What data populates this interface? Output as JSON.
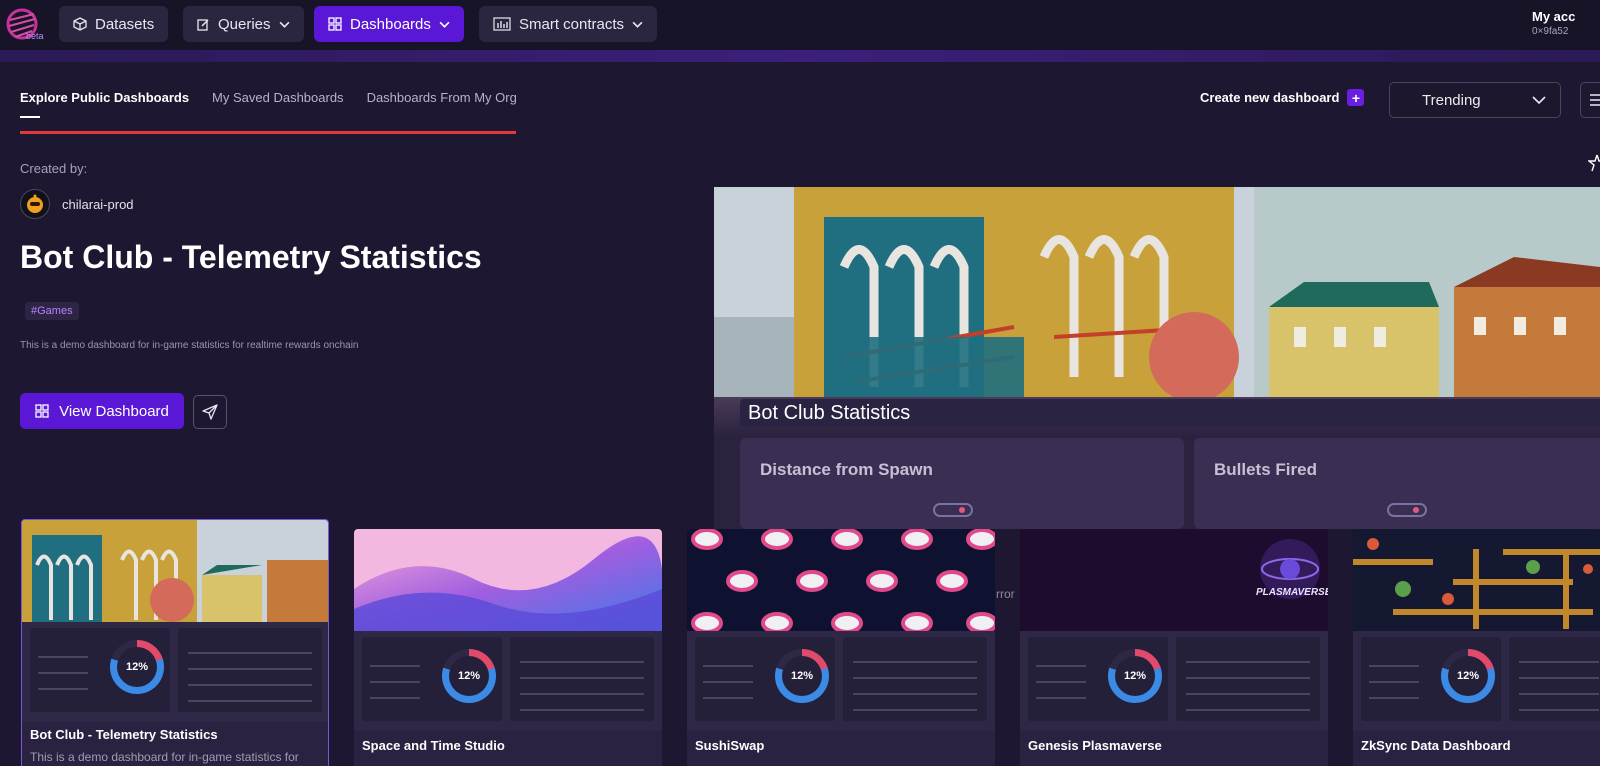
{
  "nav": {
    "logo_badge": "beta",
    "items": [
      {
        "label": "Datasets",
        "icon": "cube-icon"
      },
      {
        "label": "Queries",
        "icon": "edit-icon"
      },
      {
        "label": "Dashboards",
        "icon": "grid-icon"
      },
      {
        "label": "Smart contracts",
        "icon": "chart-icon"
      }
    ],
    "account_name": "My acc",
    "account_address": "0×9fa52"
  },
  "tabs": [
    {
      "label": "Explore Public Dashboards",
      "active": true
    },
    {
      "label": "My Saved Dashboards",
      "active": false
    },
    {
      "label": "Dashboards From My Org",
      "active": false
    }
  ],
  "toolbar": {
    "create_label": "Create new dashboard",
    "sort_value": "Trending"
  },
  "featured": {
    "created_by_label": "Created by:",
    "creator": "chilarai-prod",
    "title": "Bot Club - Telemetry Statistics",
    "tag": "#Games",
    "description": "This is a demo dashboard for in-game statistics for realtime rewards onchain",
    "view_label": "View Dashboard",
    "preview": {
      "title": "Bot Club Statistics",
      "cards": [
        "Distance from Spawn",
        "Bullets Fired"
      ],
      "error_fragment": "rror"
    }
  },
  "cards": [
    {
      "title": "Bot Club - Telemetry Statistics",
      "description": "This is a demo dashboard for in-game statistics for",
      "ring": "12%"
    },
    {
      "title": "Space and Time Studio",
      "description": "",
      "ring": "12%"
    },
    {
      "title": "SushiSwap",
      "description": "",
      "ring": "12%"
    },
    {
      "title": "Genesis Plasmaverse",
      "description": "",
      "ring": "12%",
      "logo_text": "PLASMAVERSE"
    },
    {
      "title": "ZkSync Data Dashboard",
      "description": "",
      "ring": "12%"
    }
  ],
  "colors": {
    "accent": "#5a18d6",
    "background": "#1e1731",
    "error_line": "#e5383b",
    "tag_text": "#b783ff"
  }
}
